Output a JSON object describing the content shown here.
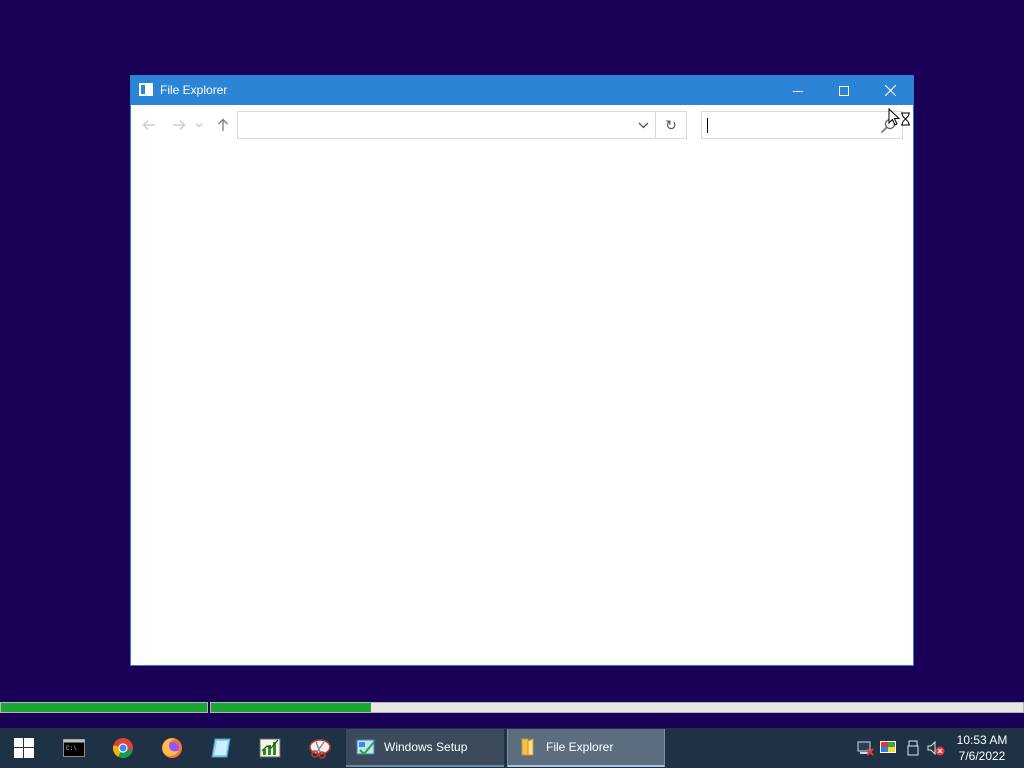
{
  "window": {
    "title": "File Explorer",
    "app_icon": "file-explorer-icon",
    "controls": {
      "minimize": "minimize-icon",
      "maximize": "maximize-icon",
      "close": "close-icon"
    },
    "toolbar": {
      "back": "arrow-left-icon",
      "forward": "arrow-right-icon",
      "recent": "chevron-down-icon",
      "up": "arrow-up-icon",
      "address_value": "",
      "address_dropdown": "chevron-down-icon",
      "refresh_glyph": "↻",
      "search_value": "",
      "search_icon": "search-icon"
    }
  },
  "progress": {
    "bar1_fraction": 1.0,
    "bar2_fraction": 0.197
  },
  "taskbar": {
    "pinned": [
      "windows-start-icon",
      "command-prompt-icon",
      "chrome-icon",
      "firefox-icon",
      "notepad-icon",
      "resource-monitor-icon",
      "snipping-tool-icon"
    ],
    "tasks": [
      {
        "label": "Windows Setup",
        "icon": "windows-setup-icon"
      },
      {
        "label": "File Explorer",
        "icon": "folder-icon",
        "active": true
      }
    ],
    "tray": [
      "network-icon",
      "display-icon",
      "usb-icon",
      "volume-muted-icon"
    ],
    "clock": {
      "time": "10:53 AM",
      "date": "7/6/2022"
    }
  },
  "colors": {
    "desktop": "#1b0057",
    "titlebar": "#2b84d6",
    "taskbar": "#1f3245",
    "progress_fill": "#1aa534"
  }
}
